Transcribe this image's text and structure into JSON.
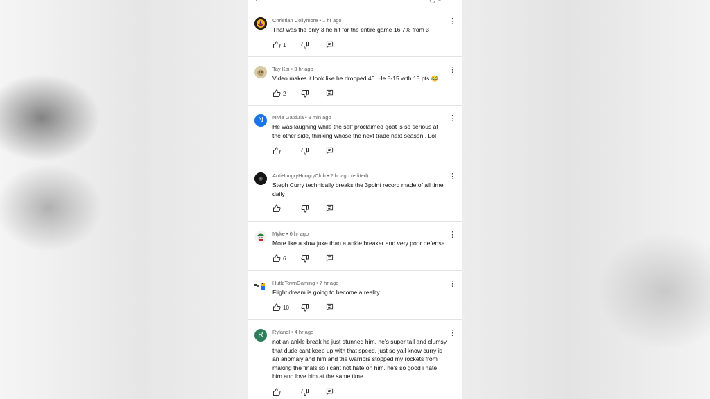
{
  "top_bar": {
    "left_glyph": "‹",
    "right_text": "(    )  ⌕"
  },
  "colors": {
    "accent_blue": "#1a73e8",
    "avatar_green": "#2e7d5b"
  },
  "comments": [
    {
      "author": "Christian Collymore",
      "time": "1 hr ago",
      "text": "That was the only 3 he hit for the entire game 16.7% from 3",
      "likes": "1",
      "avatar_icon": "lakers-logo-avatar"
    },
    {
      "author": "Tay Kai",
      "time": "3 hr ago",
      "text": "Video makes it look like he dropped 40. He 5-15 with 15 pts 😂",
      "likes": "2",
      "avatar_icon": "dog-photo-avatar"
    },
    {
      "author": "Nivia Gatdula",
      "time": "9 min ago",
      "text": "He was laughing while the self proclaimed goat is so serious at the other side, thinking whose the next trade next season.. Lol",
      "likes": "",
      "avatar_letter": "N"
    },
    {
      "author": "AntiHungryHungryClub",
      "time": "2 hr ago (edited)",
      "text": "Steph Curry technically breaks the 3point record made of all time daily",
      "likes": "",
      "avatar_icon": "dark-photo-avatar"
    },
    {
      "author": "Myke",
      "time": "6 hr ago",
      "text": "More like a slow juke than a ankle breaker and very poor defense.",
      "likes": "6",
      "avatar_icon": "green-character-avatar"
    },
    {
      "author": "HutleTownGaming",
      "time": "7 hr ago",
      "text": "Flight dream is going to become a reality",
      "likes": "10",
      "avatar_icon": "pixel-art-avatar"
    },
    {
      "author": "Rylanol",
      "time": "4 hr ago",
      "text": "not an ankle break he just stunned him. he's super tall and clumsy that dude cant keep up with that speed. just so yall know curry is an anomaly and him and the warriors stopped my rockets from making the finals so i cant not hate on him. he's so good i hate him and love him at the same time",
      "likes": "",
      "avatar_letter": "R"
    }
  ]
}
